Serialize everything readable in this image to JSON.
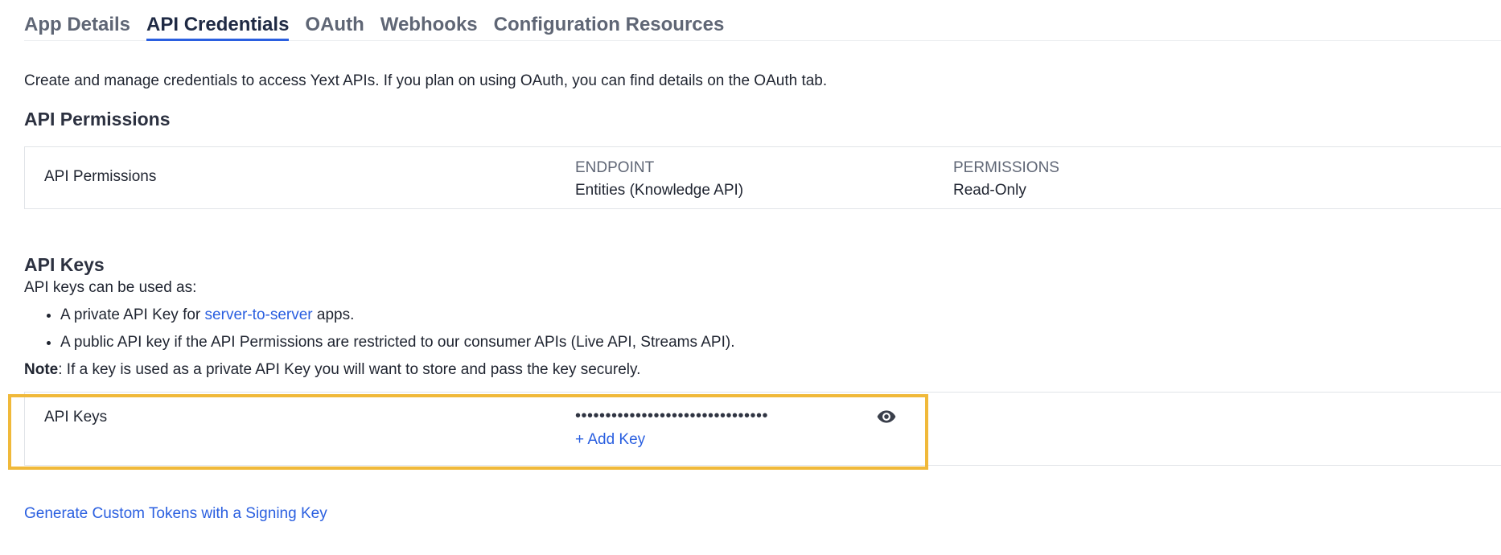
{
  "tabs": [
    {
      "label": "App Details",
      "active": false
    },
    {
      "label": "API Credentials",
      "active": true
    },
    {
      "label": "OAuth",
      "active": false
    },
    {
      "label": "Webhooks",
      "active": false
    },
    {
      "label": "Configuration Resources",
      "active": false
    }
  ],
  "intro": "Create and manage credentials to access Yext APIs. If you plan on using OAuth, you can find details on the OAuth tab.",
  "permissions": {
    "section_title": "API Permissions",
    "row_label": "API Permissions",
    "endpoint_header": "ENDPOINT",
    "endpoint_value": "Entities (Knowledge API)",
    "permissions_header": "PERMISSIONS",
    "permissions_value": "Read-Only"
  },
  "keys": {
    "section_title": "API Keys",
    "lead": "API keys can be used as:",
    "bullet1_prefix": "A private API Key for ",
    "bullet1_link": "server-to-server",
    "bullet1_suffix": " apps.",
    "bullet2": "A public API key if the API Permissions are restricted to our consumer APIs (Live API, Streams API).",
    "note_label": "Note",
    "note_text": ": If a key is used as a private API Key you will want to store and pass the key securely.",
    "row_label": "API Keys",
    "masked_key": "••••••••••••••••••••••••••••••••",
    "reveal_icon": "eye-icon",
    "add_key_label": "+ Add Key"
  },
  "footer_link": "Generate Custom Tokens with a Signing Key",
  "colors": {
    "link": "#2a5fe0",
    "highlight": "#f0b93a",
    "active_tab_underline": "#2a5fe0"
  }
}
